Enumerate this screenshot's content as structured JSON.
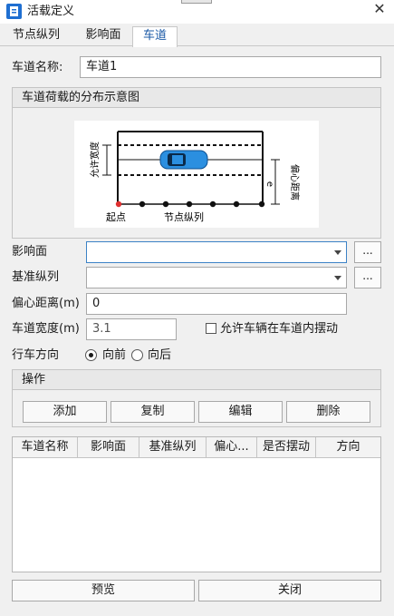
{
  "window": {
    "title": "活载定义",
    "close_glyph": "✕"
  },
  "tabs": [
    {
      "label": "节点纵列"
    },
    {
      "label": "影响面"
    },
    {
      "label": "车道"
    }
  ],
  "lane": {
    "name_label": "车道名称:",
    "name_value": "车道1",
    "diagram_group_title": "车道荷载的分布示意图",
    "diagram": {
      "allow_width_text": "允许宽度",
      "eccentric_text": "偏心距离",
      "e_symbol": "e",
      "start_text": "起点",
      "nodes_text": "节点纵列"
    },
    "influence_label": "影响面",
    "influence_value": "",
    "column_label": "基准纵列",
    "column_value": "",
    "ellipsis": "...",
    "eccentric_label": "偏心距离(m)",
    "eccentric_value": "0",
    "width_label": "车道宽度(m)",
    "width_value": "3.1",
    "swing_label": "允许车辆在车道内摆动",
    "swing_checked": false,
    "direction_label": "行车方向",
    "forward_label": "向前",
    "backward_label": "向后",
    "direction_selected": "forward"
  },
  "operations": {
    "title": "操作",
    "add": "添加",
    "copy": "复制",
    "edit": "编辑",
    "delete": "删除"
  },
  "table": {
    "columns": [
      "车道名称",
      "影响面",
      "基准纵列",
      "偏心...",
      "是否摆动",
      "方向"
    ],
    "rows": []
  },
  "footer": {
    "preview": "预览",
    "close": "关闭"
  },
  "colors": {
    "accent": "#1b5aa6",
    "car": "#2b8fe0",
    "start_node": "#e03030"
  }
}
